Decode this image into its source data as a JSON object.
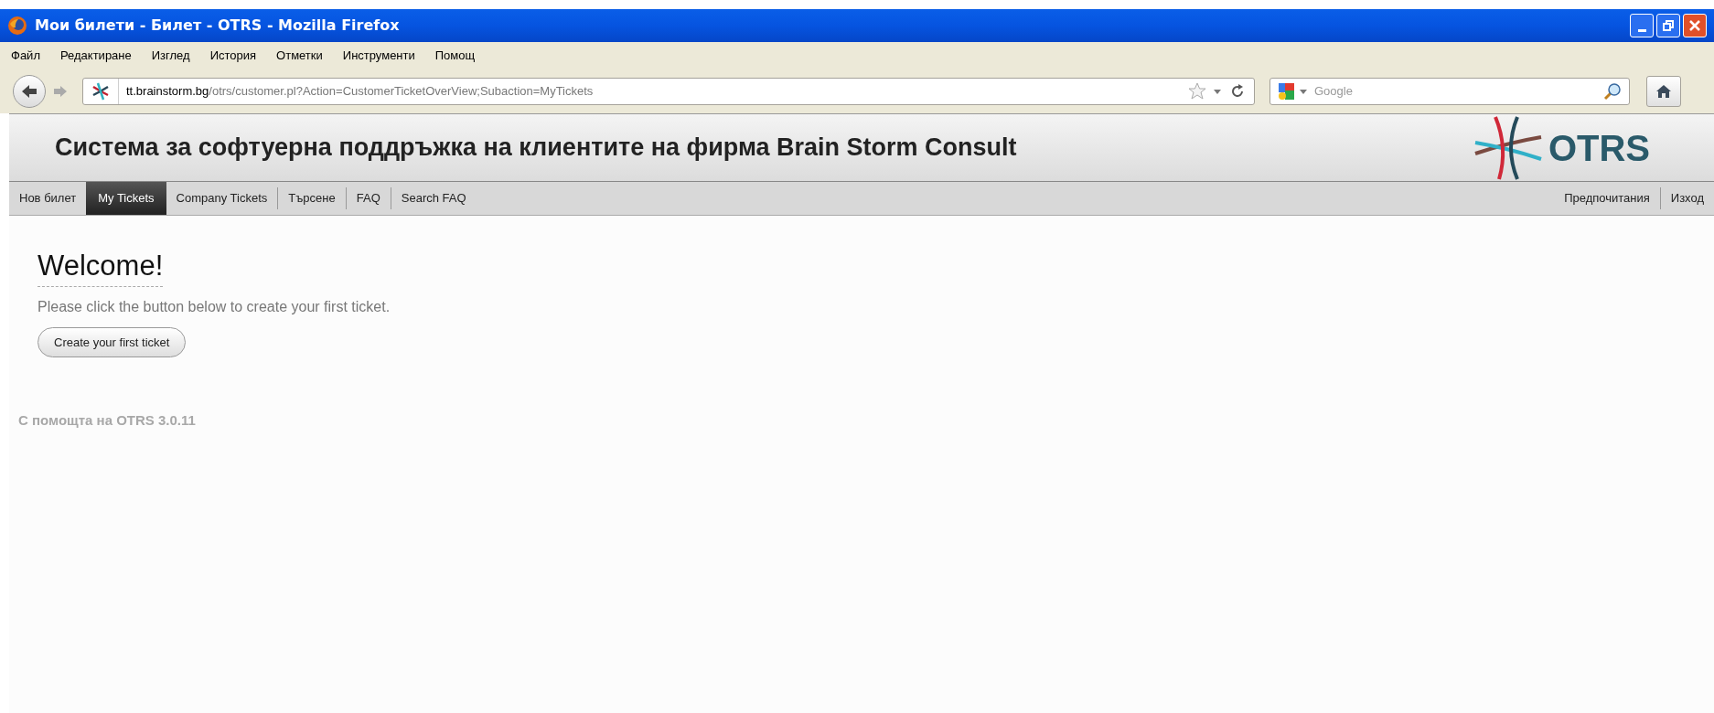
{
  "window": {
    "title": "Мои билети - Билет - OTRS - Mozilla Firefox"
  },
  "menu": [
    "Файл",
    "Редактиране",
    "Изглед",
    "История",
    "Отметки",
    "Инструменти",
    "Помощ"
  ],
  "address_bar": {
    "host": "tt.brainstorm.bg",
    "path": "/otrs/customer.pl?Action=CustomerTicketOverView;Subaction=MyTickets"
  },
  "search": {
    "placeholder": "Google"
  },
  "header": {
    "title": "Система за софтуерна поддръжка на клиентите на фирма Brain Storm Consult",
    "logo_text": "OTRS"
  },
  "nav": {
    "items": [
      {
        "label": "Нов билет",
        "selected": false
      },
      {
        "label": "My Tickets",
        "selected": true
      },
      {
        "label": "Company Tickets",
        "selected": false
      },
      {
        "label": "Търсене",
        "selected": false
      },
      {
        "label": "FAQ",
        "selected": false
      },
      {
        "label": "Search FAQ",
        "selected": false
      }
    ],
    "right_items": [
      {
        "label": "Предпочитания",
        "selected": false
      },
      {
        "label": "Изход",
        "selected": false
      }
    ]
  },
  "content": {
    "heading": "Welcome!",
    "message": "Please click the button below to create your first ticket.",
    "button": "Create your first ticket"
  },
  "footer": "С помощта на OTRS 3.0.11"
}
